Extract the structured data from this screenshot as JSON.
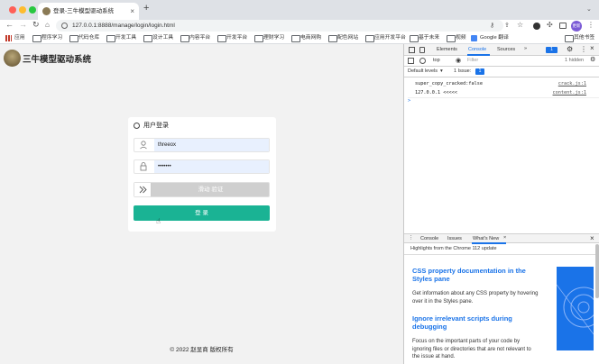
{
  "browser": {
    "tab_title": "登录-三牛模型驱动系统",
    "url": "127.0.0.1:8888/manage/login/login.html",
    "avatar_text": "更新",
    "new_tab_symbol": "+",
    "bookmarks": [
      "应用",
      "程序学习",
      "代码仓库",
      "开发工具",
      "设计工具",
      "内容平台",
      "开发平台",
      "理财学习",
      "电商网购",
      "配色网站",
      "应用开发平台",
      "基于未来",
      "视频",
      "Google 翻译"
    ],
    "other_bookmarks": "其他书签"
  },
  "app": {
    "logo_title": "三牛模型驱动系统",
    "login_title": "用户登录",
    "username_value": "threeox",
    "password_value": "•••••••",
    "slider_text": "滑动 验证",
    "login_button": "登 录",
    "footer": "© 2022 赵显商 版权所有",
    "accent_color": "#1ab394"
  },
  "devtools": {
    "tabs": [
      "Elements",
      "Console",
      "Sources"
    ],
    "more": "»",
    "badge_count": "1",
    "context": "top",
    "filter_placeholder": "Filter",
    "hidden_label": "1 hidden",
    "levels": "Default levels",
    "issue_label": "1 Issue:",
    "issue_count": "1",
    "console_lines": [
      {
        "text": "super_copy_cracked:false",
        "source": "crack.js:1"
      },
      {
        "text": "127.0.0.1 <<<<<",
        "source": "content.js:1"
      }
    ],
    "prompt": ">",
    "drawer_tabs": [
      "Console",
      "Issues",
      "What's New"
    ],
    "drawer_header": "Highlights from the Chrome 112 update",
    "whatsnew": [
      {
        "title": "CSS property documentation in the Styles pane",
        "body": "Get information about any CSS property by hovering over it in the Styles pane."
      },
      {
        "title": "Ignore irrelevant scripts during debugging",
        "body": "Focus on the important parts of your code by ignoring files or directories that are not relevant to the issue at hand."
      }
    ]
  }
}
